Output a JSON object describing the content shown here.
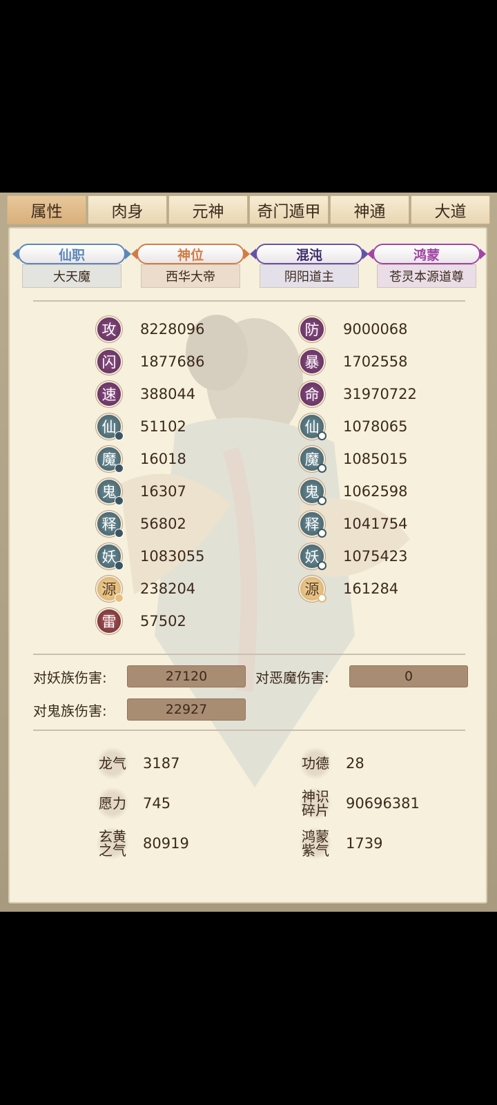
{
  "tabs": [
    "属性",
    "肉身",
    "元神",
    "奇门遁甲",
    "神通",
    "大道"
  ],
  "active_tab": "属性",
  "ranks": [
    {
      "title": "仙职",
      "value": "大天魔",
      "color": "#5c87b8"
    },
    {
      "title": "神位",
      "value": "西华大帝",
      "color": "#d07d45"
    },
    {
      "title": "混沌",
      "value": "阴阳道主",
      "color": "#6552a8"
    },
    {
      "title": "鸿蒙",
      "value": "苍灵本源道尊",
      "color": "#a244a6"
    }
  ],
  "stats_left": [
    {
      "icon": "攻",
      "value": "8228096",
      "style": "purple",
      "dot": ""
    },
    {
      "icon": "闪",
      "value": "1877686",
      "style": "purple",
      "dot": ""
    },
    {
      "icon": "速",
      "value": "388044",
      "style": "purple",
      "dot": ""
    },
    {
      "icon": "仙",
      "value": "51102",
      "style": "teal",
      "dot": "solid"
    },
    {
      "icon": "魔",
      "value": "16018",
      "style": "teal",
      "dot": "solid"
    },
    {
      "icon": "鬼",
      "value": "16307",
      "style": "teal",
      "dot": "solid"
    },
    {
      "icon": "释",
      "value": "56802",
      "style": "teal",
      "dot": "solid"
    },
    {
      "icon": "妖",
      "value": "1083055",
      "style": "teal",
      "dot": "solid"
    },
    {
      "icon": "源",
      "value": "238204",
      "style": "gold",
      "dot": "gold"
    },
    {
      "icon": "雷",
      "value": "57502",
      "style": "red",
      "dot": ""
    }
  ],
  "stats_right": [
    {
      "icon": "防",
      "value": "9000068",
      "style": "purple",
      "dot": ""
    },
    {
      "icon": "暴",
      "value": "1702558",
      "style": "purple",
      "dot": ""
    },
    {
      "icon": "命",
      "value": "31970722",
      "style": "purple",
      "dot": ""
    },
    {
      "icon": "仙",
      "value": "1078065",
      "style": "teal",
      "dot": "ring"
    },
    {
      "icon": "魔",
      "value": "1085015",
      "style": "teal",
      "dot": "ring"
    },
    {
      "icon": "鬼",
      "value": "1062598",
      "style": "teal",
      "dot": "ring"
    },
    {
      "icon": "释",
      "value": "1041754",
      "style": "teal",
      "dot": "ring"
    },
    {
      "icon": "妖",
      "value": "1075423",
      "style": "teal",
      "dot": "ring"
    },
    {
      "icon": "源",
      "value": "161284",
      "style": "gold",
      "dot": "goldring"
    }
  ],
  "damage": {
    "vs_yao_label": "对妖族伤害:",
    "vs_yao_value": "27120",
    "vs_demon_label": "对恶魔伤害:",
    "vs_demon_value": "0",
    "vs_gui_label": "对鬼族伤害:",
    "vs_gui_value": "22927"
  },
  "resources": [
    {
      "label": "龙气",
      "value": "3187"
    },
    {
      "label": "功德",
      "value": "28"
    },
    {
      "label": "愿力",
      "value": "745"
    },
    {
      "label": "神识碎片",
      "value": "90696381"
    },
    {
      "label": "玄黄之气",
      "value": "80919"
    },
    {
      "label": "鸿蒙紫气",
      "value": "1739"
    }
  ]
}
